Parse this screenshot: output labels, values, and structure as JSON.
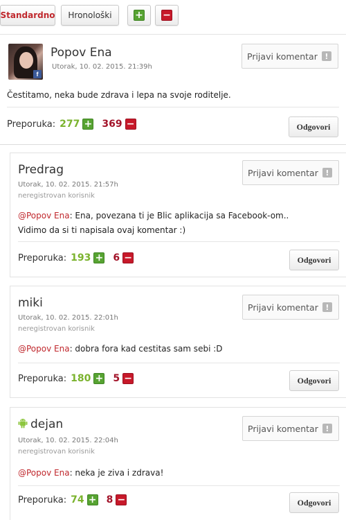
{
  "toolbar": {
    "standardno": "Standardno",
    "hronoloski": "Hronološki"
  },
  "labels": {
    "report": "Prijavi komentar",
    "reply": "Odgovori",
    "recommend": "Preporuka:",
    "unregistered": "neregistrovan korisnik",
    "mention": "@Popov Ena"
  },
  "comments": [
    {
      "author": "Popov Ena",
      "date": "Utorak, 10. 02. 2015. 21:39h",
      "text": "Čestitamo, neka bude zdrava i lepa na svoje roditelje.",
      "likes": "277",
      "dislikes": "369"
    },
    {
      "author": "Predrag",
      "date": "Utorak, 10. 02. 2015. 21:57h",
      "text_line1": ": Ena, povezana ti je Blic aplikacija sa Facebook-om..",
      "text_line2": "Vidimo da si ti napisala ovaj komentar :)",
      "likes": "193",
      "dislikes": "6"
    },
    {
      "author": "miki",
      "date": "Utorak, 10. 02. 2015. 22:01h",
      "text": ": dobra fora kad cestitas sam sebi :D",
      "likes": "180",
      "dislikes": "5"
    },
    {
      "author": "dejan",
      "date": "Utorak, 10. 02. 2015. 22:04h",
      "text": ": neka je ziva i zdrava!",
      "likes": "74",
      "dislikes": "8",
      "platform_icon": "android-icon"
    }
  ],
  "colors": {
    "accent_red": "#c0282d",
    "like_green": "#7bb32e",
    "dislike_red": "#a3142a"
  }
}
